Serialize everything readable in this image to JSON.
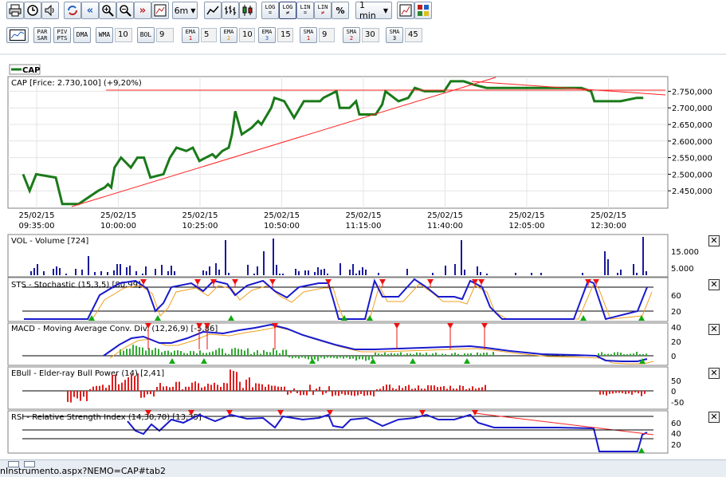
{
  "toolbar": {
    "timeframe": "6m",
    "interval": "1 min",
    "log_label": "LOG",
    "log_sub": "=",
    "log2_label": "LOG",
    "log2_sub": "≠",
    "lin_label": "LIN",
    "lin_sub": "=",
    "lin2_label": "LIN",
    "lin2_sub": "≠",
    "pct_label": "%"
  },
  "indicators_bar": {
    "par_sar": "PAR SAR",
    "piv_pts": "PIV PTS",
    "dma": "DMA",
    "wma": "WMA",
    "wma_value": "10",
    "bol": "BOL",
    "bol_value": "9",
    "ema1": "EMA",
    "ema1_sub": "1",
    "ema1_value": "5",
    "ema2": "EMA",
    "ema2_sub": "2",
    "ema2_value": "10",
    "ema3": "EMA",
    "ema3_sub": "3",
    "ema3_value": "15",
    "sma1": "SMA",
    "sma1_sub": "1",
    "sma1_value": "9",
    "sma2": "SMA",
    "sma2_sub": "2",
    "sma2_value": "30",
    "sma3": "SMA",
    "sma3_sub": "3",
    "sma3_value": "45"
  },
  "colors": {
    "price_line": "#1a7a1a",
    "trendline": "#ff2020",
    "indicator_line": "#1a1acc",
    "signal_line": "#f0a020",
    "bull_bar": "#dd2020",
    "macd_hist": "#33aa33",
    "volume_bar": "#1a1a9a",
    "panel_border": "#808080"
  },
  "main_chart": {
    "legend": "CAP",
    "header": "CAP [Price: 2.730,100] (+9,20%)",
    "y_ticks": [
      "2.750,000",
      "2.700,000",
      "2.650,000",
      "2.600,000",
      "2.550,000",
      "2.500,000",
      "2.450,000"
    ],
    "x_ticks": [
      {
        "date": "25/02/15",
        "time": "09:35:00"
      },
      {
        "date": "25/02/15",
        "time": "10:00:00"
      },
      {
        "date": "25/02/15",
        "time": "10:25:00"
      },
      {
        "date": "25/02/15",
        "time": "10:50:00"
      },
      {
        "date": "25/02/15",
        "time": "11:15:00"
      },
      {
        "date": "25/02/15",
        "time": "11:40:00"
      },
      {
        "date": "25/02/15",
        "time": "12:05:00"
      },
      {
        "date": "25/02/15",
        "time": "12:30:00"
      }
    ]
  },
  "panels": {
    "vol": {
      "title": "VOL - Volume [724]",
      "ticks": [
        "15.000",
        "5.000"
      ]
    },
    "sts": {
      "title": "STS - Stochastic (15,3,5) [80,99]",
      "ticks": [
        "60",
        "20"
      ]
    },
    "macd": {
      "title": "MACD - Moving Average Conv. Div. (12,26,9) [-5,86]",
      "ticks": [
        "40",
        "20",
        "0"
      ]
    },
    "ebull": {
      "title": "EBull - Elder-ray Bull Power (14) [2,41]",
      "ticks": [
        "50",
        "0",
        "-50"
      ]
    },
    "rsi": {
      "title": "RSI - Relative Strength Index (14,30,70) [13,35]",
      "ticks": [
        "60",
        "40",
        "20"
      ]
    }
  },
  "chart_data": {
    "type": "line",
    "title": "CAP [Price: 2.730,100] (+9,20%)",
    "x_range": [
      "09:35",
      "12:45"
    ],
    "ylim": [
      2400000,
      2770000
    ],
    "series": [
      {
        "name": "CAP",
        "x": [
          "09:35",
          "09:37",
          "09:39",
          "09:45",
          "09:47",
          "09:52",
          "09:58",
          "10:00",
          "10:01",
          "10:02",
          "10:03",
          "10:05",
          "10:08",
          "10:10",
          "10:12",
          "10:14",
          "10:18",
          "10:20",
          "10:22",
          "10:25",
          "10:27",
          "10:29",
          "10:33",
          "10:34",
          "10:36",
          "10:38",
          "10:39",
          "10:40",
          "10:42",
          "10:45",
          "10:47",
          "10:48",
          "10:51",
          "10:52",
          "10:55",
          "10:58",
          "11:01",
          "11:04",
          "11:06",
          "11:07",
          "11:11",
          "11:12",
          "11:15",
          "11:17",
          "11:18",
          "11:23",
          "11:25",
          "11:26",
          "11:30",
          "11:33",
          "11:35",
          "11:38",
          "11:41",
          "11:44",
          "11:46",
          "11:48",
          "11:50",
          "11:53",
          "11:57",
          "12:00",
          "12:06",
          "12:10",
          "12:14",
          "12:20",
          "12:26",
          "12:29",
          "12:30",
          "12:33",
          "12:38",
          "12:43",
          "12:45"
        ],
        "y": [
          2500000,
          2450000,
          2500000,
          2490000,
          2410000,
          2410000,
          2450000,
          2460000,
          2470000,
          2460000,
          2520000,
          2550000,
          2520000,
          2550000,
          2550000,
          2490000,
          2500000,
          2550000,
          2580000,
          2570000,
          2580000,
          2540000,
          2560000,
          2550000,
          2570000,
          2580000,
          2620000,
          2690000,
          2620000,
          2640000,
          2660000,
          2650000,
          2700000,
          2730000,
          2720000,
          2670000,
          2720000,
          2720000,
          2720000,
          2730000,
          2750000,
          2700000,
          2700000,
          2720000,
          2680000,
          2680000,
          2710000,
          2750000,
          2720000,
          2730000,
          2760000,
          2750000,
          2750000,
          2750000,
          2780000,
          2780000,
          2780000,
          2770000,
          2760000,
          2760000,
          2760000,
          2760000,
          2760000,
          2760000,
          2760000,
          2750000,
          2720000,
          2720000,
          2720000,
          2730000,
          2730100
        ]
      },
      {
        "name": "Volume",
        "x": [
          "09:35",
          "12:45"
        ],
        "y": [
          0,
          724
        ]
      }
    ]
  }
}
